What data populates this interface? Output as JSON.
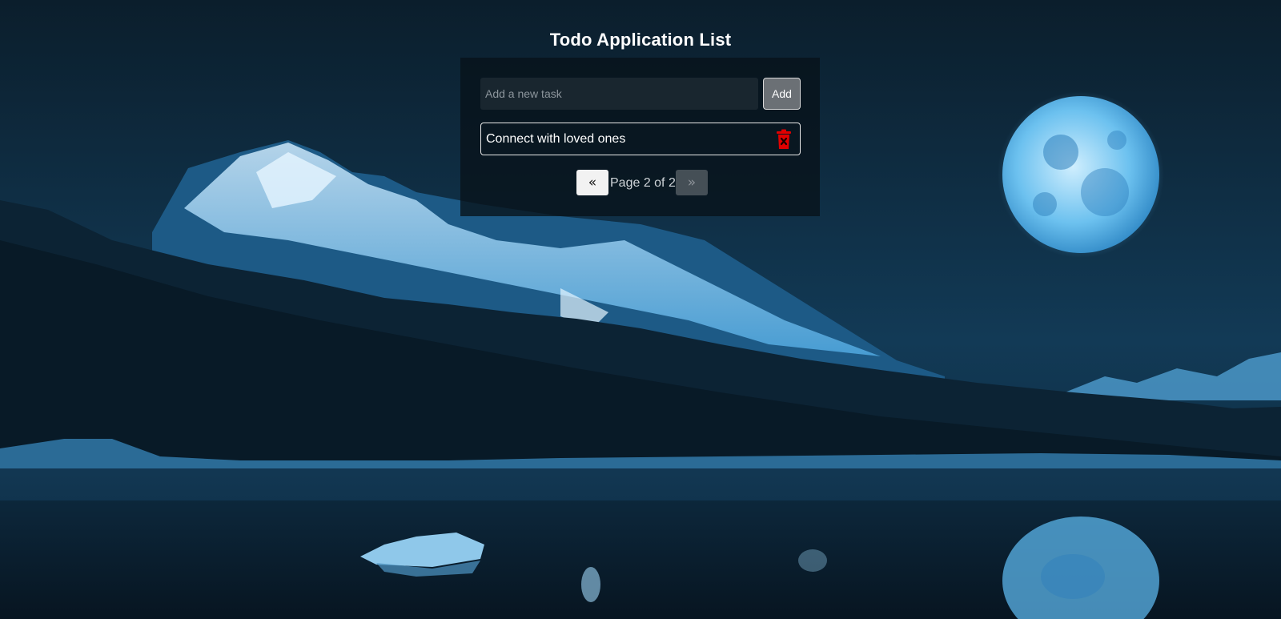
{
  "app": {
    "title": "Todo Application List"
  },
  "add_form": {
    "placeholder": "Add a new task",
    "value": "",
    "add_label": "Add"
  },
  "tasks": [
    {
      "text": "Connect with loved ones",
      "delete_icon": "trash-icon"
    }
  ],
  "pagination": {
    "prev_label": "«",
    "next_label": "»",
    "page_text": "Page 2 of 2",
    "current_page": 2,
    "total_pages": 2,
    "next_disabled": true
  },
  "colors": {
    "accent_delete": "#e00000",
    "card_background": "#08121a",
    "add_button": "#6b7075"
  }
}
